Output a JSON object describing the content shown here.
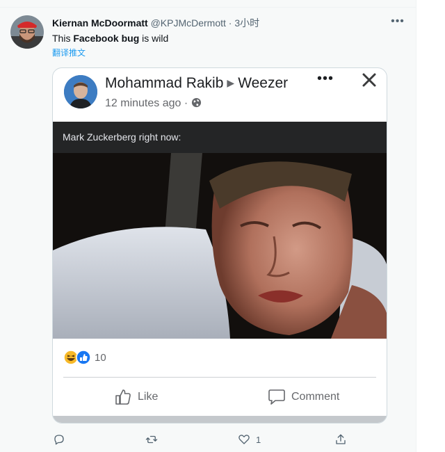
{
  "tweet": {
    "display_name": "Kiernan McDoormatt",
    "handle": "@KPJMcDermott",
    "separator": " · ",
    "time": "3小时",
    "text_before": "This ",
    "text_bold": "Facebook bug",
    "text_after": " is wild",
    "translate_label": "翻译推文",
    "more_label": "•••"
  },
  "fb_post": {
    "author": "Mohammad Rakib",
    "arrow": "▶",
    "group": "Weezer",
    "timestamp": "12 minutes ago",
    "dot": "·",
    "more_label": "•••",
    "caption": "Mark Zuckerberg right now:",
    "reaction_count": "10",
    "like_label": "Like",
    "comment_label": "Comment"
  },
  "tweet_actions": {
    "reply_count": "",
    "retweet_count": "",
    "like_count": "1"
  },
  "icons": {
    "reply": "reply-icon",
    "retweet": "retweet-icon",
    "heart": "heart-icon",
    "share": "share-icon",
    "globe": "globe-icon",
    "close": "close-icon"
  },
  "colors": {
    "link": "#1d9bf0",
    "caption_bar": "#242526",
    "fb_like_blue": "#1877f2",
    "haha_yellow": "#f7b928"
  }
}
